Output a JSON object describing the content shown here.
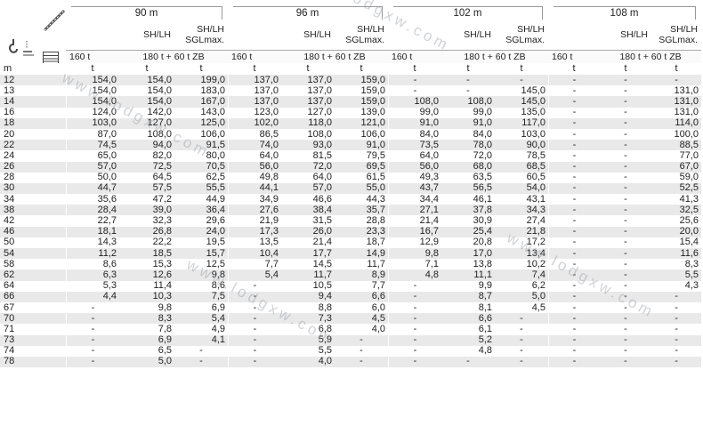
{
  "boom_lengths": [
    "90 m",
    "96 m",
    "102 m",
    "108 m"
  ],
  "mode_headers": {
    "sh_lh": "SH/LH",
    "sh_lh_sgl_line1": "SH/LH",
    "sh_lh_sgl_line2": "SGLmax."
  },
  "counterweights": {
    "cw1": "160 t",
    "cw2": "180 t + 60 t ZB"
  },
  "units": {
    "radius": "m",
    "load": "t"
  },
  "rows": [
    {
      "r": "12",
      "v": [
        "154,0",
        "154,0",
        "199,0",
        "137,0",
        "137,0",
        "159,0",
        "-",
        "-",
        "-",
        "-",
        "-",
        "-"
      ]
    },
    {
      "r": "13",
      "v": [
        "154,0",
        "154,0",
        "183,0",
        "137,0",
        "137,0",
        "159,0",
        "-",
        "-",
        "145,0",
        "-",
        "-",
        "131,0"
      ]
    },
    {
      "r": "14",
      "v": [
        "154,0",
        "154,0",
        "167,0",
        "137,0",
        "137,0",
        "159,0",
        "108,0",
        "108,0",
        "145,0",
        "-",
        "-",
        "131,0"
      ]
    },
    {
      "r": "16",
      "v": [
        "124,0",
        "142,0",
        "143,0",
        "123,0",
        "127,0",
        "139,0",
        "99,0",
        "99,0",
        "135,0",
        "-",
        "-",
        "131,0"
      ]
    },
    {
      "r": "18",
      "v": [
        "103,0",
        "127,0",
        "125,0",
        "102,0",
        "118,0",
        "121,0",
        "91,0",
        "91,0",
        "117,0",
        "-",
        "-",
        "114,0"
      ]
    },
    {
      "r": "20",
      "v": [
        "87,0",
        "108,0",
        "106,0",
        "86,5",
        "108,0",
        "106,0",
        "84,0",
        "84,0",
        "103,0",
        "-",
        "-",
        "100,0"
      ]
    },
    {
      "r": "22",
      "v": [
        "74,5",
        "94,0",
        "91,5",
        "74,0",
        "93,0",
        "91,0",
        "73,5",
        "78,0",
        "90,0",
        "-",
        "-",
        "88,5"
      ]
    },
    {
      "r": "24",
      "v": [
        "65,0",
        "82,0",
        "80,0",
        "64,0",
        "81,5",
        "79,5",
        "64,0",
        "72,0",
        "78,5",
        "-",
        "-",
        "77,0"
      ]
    },
    {
      "r": "26",
      "v": [
        "57,0",
        "72,5",
        "70,5",
        "56,0",
        "72,0",
        "69,5",
        "56,0",
        "68,0",
        "68,5",
        "-",
        "-",
        "67,0"
      ]
    },
    {
      "r": "28",
      "v": [
        "50,0",
        "64,5",
        "62,5",
        "49,8",
        "64,0",
        "61,5",
        "49,3",
        "63,5",
        "60,5",
        "-",
        "-",
        "59,0"
      ]
    },
    {
      "r": "30",
      "v": [
        "44,7",
        "57,5",
        "55,5",
        "44,1",
        "57,0",
        "55,0",
        "43,7",
        "56,5",
        "54,0",
        "-",
        "-",
        "52,5"
      ]
    },
    {
      "r": "34",
      "v": [
        "35,6",
        "47,2",
        "44,9",
        "34,9",
        "46,6",
        "44,3",
        "34,4",
        "46,1",
        "43,1",
        "-",
        "-",
        "41,3"
      ]
    },
    {
      "r": "38",
      "v": [
        "28,4",
        "39,0",
        "36,4",
        "27,6",
        "38,4",
        "35,7",
        "27,1",
        "37,8",
        "34,3",
        "-",
        "-",
        "32,5"
      ]
    },
    {
      "r": "42",
      "v": [
        "22,7",
        "32,3",
        "29,6",
        "21,9",
        "31,5",
        "28,8",
        "21,4",
        "30,9",
        "27,4",
        "-",
        "-",
        "25,6"
      ]
    },
    {
      "r": "46",
      "v": [
        "18,1",
        "26,8",
        "24,0",
        "17,3",
        "26,0",
        "23,3",
        "16,7",
        "25,4",
        "21,8",
        "-",
        "-",
        "20,0"
      ]
    },
    {
      "r": "50",
      "v": [
        "14,3",
        "22,2",
        "19,5",
        "13,5",
        "21,4",
        "18,7",
        "12,9",
        "20,8",
        "17,2",
        "-",
        "-",
        "15,4"
      ]
    },
    {
      "r": "54",
      "v": [
        "11,2",
        "18,5",
        "15,7",
        "10,4",
        "17,7",
        "14,9",
        "9,8",
        "17,0",
        "13,4",
        "-",
        "-",
        "11,6"
      ]
    },
    {
      "r": "58",
      "v": [
        "8,6",
        "15,3",
        "12,5",
        "7,7",
        "14,5",
        "11,7",
        "7,1",
        "13,8",
        "10,2",
        "-",
        "-",
        "8,3"
      ]
    },
    {
      "r": "62",
      "v": [
        "6,3",
        "12,6",
        "9,8",
        "5,4",
        "11,7",
        "8,9",
        "4,8",
        "11,1",
        "7,4",
        "-",
        "-",
        "5,5"
      ]
    },
    {
      "r": "64",
      "v": [
        "5,3",
        "11,4",
        "8,6",
        "-",
        "10,5",
        "7,7",
        "-",
        "9,9",
        "6,2",
        "-",
        "-",
        "4,3"
      ]
    },
    {
      "r": "66",
      "v": [
        "4,4",
        "10,3",
        "7,5",
        "-",
        "9,4",
        "6,6",
        "-",
        "8,7",
        "5,0",
        "-",
        "-",
        "-"
      ]
    },
    {
      "r": "67",
      "v": [
        "-",
        "9,8",
        "6,9",
        "-",
        "8,8",
        "6,0",
        "-",
        "8,1",
        "4,5",
        "-",
        "-",
        "-"
      ]
    },
    {
      "r": "70",
      "v": [
        "-",
        "8,3",
        "5,4",
        "-",
        "7,3",
        "4,5",
        "-",
        "6,6",
        "-",
        "-",
        "-",
        "-"
      ]
    },
    {
      "r": "71",
      "v": [
        "-",
        "7,8",
        "4,9",
        "-",
        "6,8",
        "4,0",
        "-",
        "6,1",
        "-",
        "-",
        "-",
        "-"
      ]
    },
    {
      "r": "73",
      "v": [
        "-",
        "6,9",
        "4,1",
        "-",
        "5,9",
        "-",
        "-",
        "5,2",
        "-",
        "-",
        "-",
        "-"
      ]
    },
    {
      "r": "74",
      "v": [
        "-",
        "6,5",
        "-",
        "-",
        "5,5",
        "-",
        "-",
        "4,8",
        "-",
        "-",
        "-",
        "-"
      ]
    },
    {
      "r": "78",
      "v": [
        "-",
        "5,0",
        "-",
        "-",
        "4,0",
        "-",
        "-",
        "-",
        "-",
        "-",
        "-",
        "-"
      ]
    }
  ],
  "watermark_text": "www.lodgxw.com",
  "icons": [
    "hook-icon",
    "boom-icon",
    "table-icon"
  ]
}
